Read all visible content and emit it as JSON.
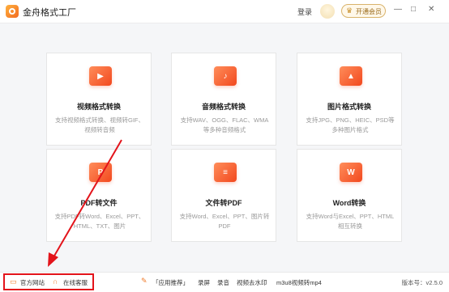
{
  "app": {
    "title": "金舟格式工厂"
  },
  "header": {
    "login": "登录",
    "vip": "开通会员",
    "minimize": "—",
    "maximize": "□",
    "close": "✕"
  },
  "cards": [
    {
      "title": "视频格式转换",
      "desc": "支持视频格式转换、视频转GIF、视频转音频",
      "icon": "video-icon",
      "glyph": "▶"
    },
    {
      "title": "音频格式转换",
      "desc": "支持WAV、OGG、FLAC、WMA等多种音频格式",
      "icon": "audio-icon",
      "glyph": "♪"
    },
    {
      "title": "图片格式转换",
      "desc": "支持JPG、PNG、HEIC、PSD等多种图片格式",
      "icon": "image-icon",
      "glyph": "▲"
    },
    {
      "title": "PDF转文件",
      "desc": "支持PDF转Word、Excel、PPT、HTML、TXT、图片",
      "icon": "pdf-icon",
      "glyph": "P"
    },
    {
      "title": "文件转PDF",
      "desc": "支持Word、Excel、PPT、图片转PDF",
      "icon": "document-icon",
      "glyph": "≡"
    },
    {
      "title": "Word转换",
      "desc": "支持Word与Excel、PPT、HTML相互转换",
      "icon": "word-icon",
      "glyph": "W"
    }
  ],
  "footer": {
    "official_site": "官方网站",
    "online_service": "在线客服",
    "recommend": "「应用推荐」",
    "links": [
      "录屏",
      "录音",
      "视频去水印",
      "m3u8视频转mp4"
    ],
    "version": "版本号：v2.5.0"
  },
  "colors": {
    "accent": "#f2481e",
    "highlight": "#e3141b"
  }
}
